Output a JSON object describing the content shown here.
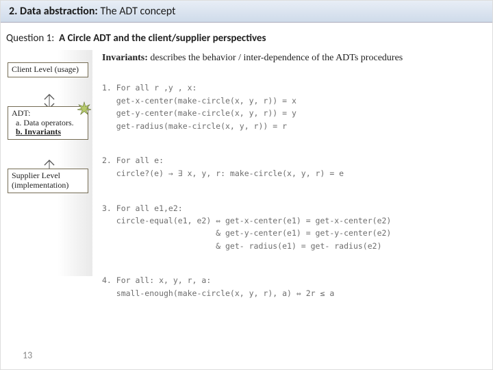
{
  "header": {
    "section_num": "2.",
    "section_title_bold": "Data abstraction:",
    "section_title_rest": "The ADT concept"
  },
  "question": {
    "label": "Question 1:",
    "topic": "A Circle ADT and the client/supplier perspectives"
  },
  "sidebar": {
    "client_box": "Client Level (usage)",
    "adt_box_title": "ADT:",
    "adt_box_a": "a. Data operators.",
    "adt_box_b": "b. Invariants",
    "supplier_box": "Supplier Level (implementation)"
  },
  "content": {
    "invariants_label": "Invariants:",
    "invariants_desc": " describes the behavior / inter-dependence of the ADTs procedures",
    "code1_head": "1. For all r ,y , x:",
    "code1_l1": "   get-x-center(make-circle(x, y, r)) = x",
    "code1_l2": "   get-y-center(make-circle(x, y, r)) = y",
    "code1_l3": "   get-radius(make-circle(x, y, r)) = r",
    "code2_head": "2. For all e:",
    "code2_l1": "   circle?(e) → ∃ x, y, r: make-circle(x, y, r) = e",
    "code3_head": "3. For all e1,e2:",
    "code3_l1": "   circle-equal(e1, e2) ⇔ get-x-center(e1) = get-x-center(e2)",
    "code3_l2": "                        & get-y-center(e1) = get-y-center(e2)",
    "code3_l3": "                        & get- radius(e1) = get- radius(e2)",
    "code4_head": "4. For all: x, y, r, a:",
    "code4_l1": "   small-enough(make-circle(x, y, r), a) ⇔ 2r ≤ a"
  },
  "pagenum": "13"
}
